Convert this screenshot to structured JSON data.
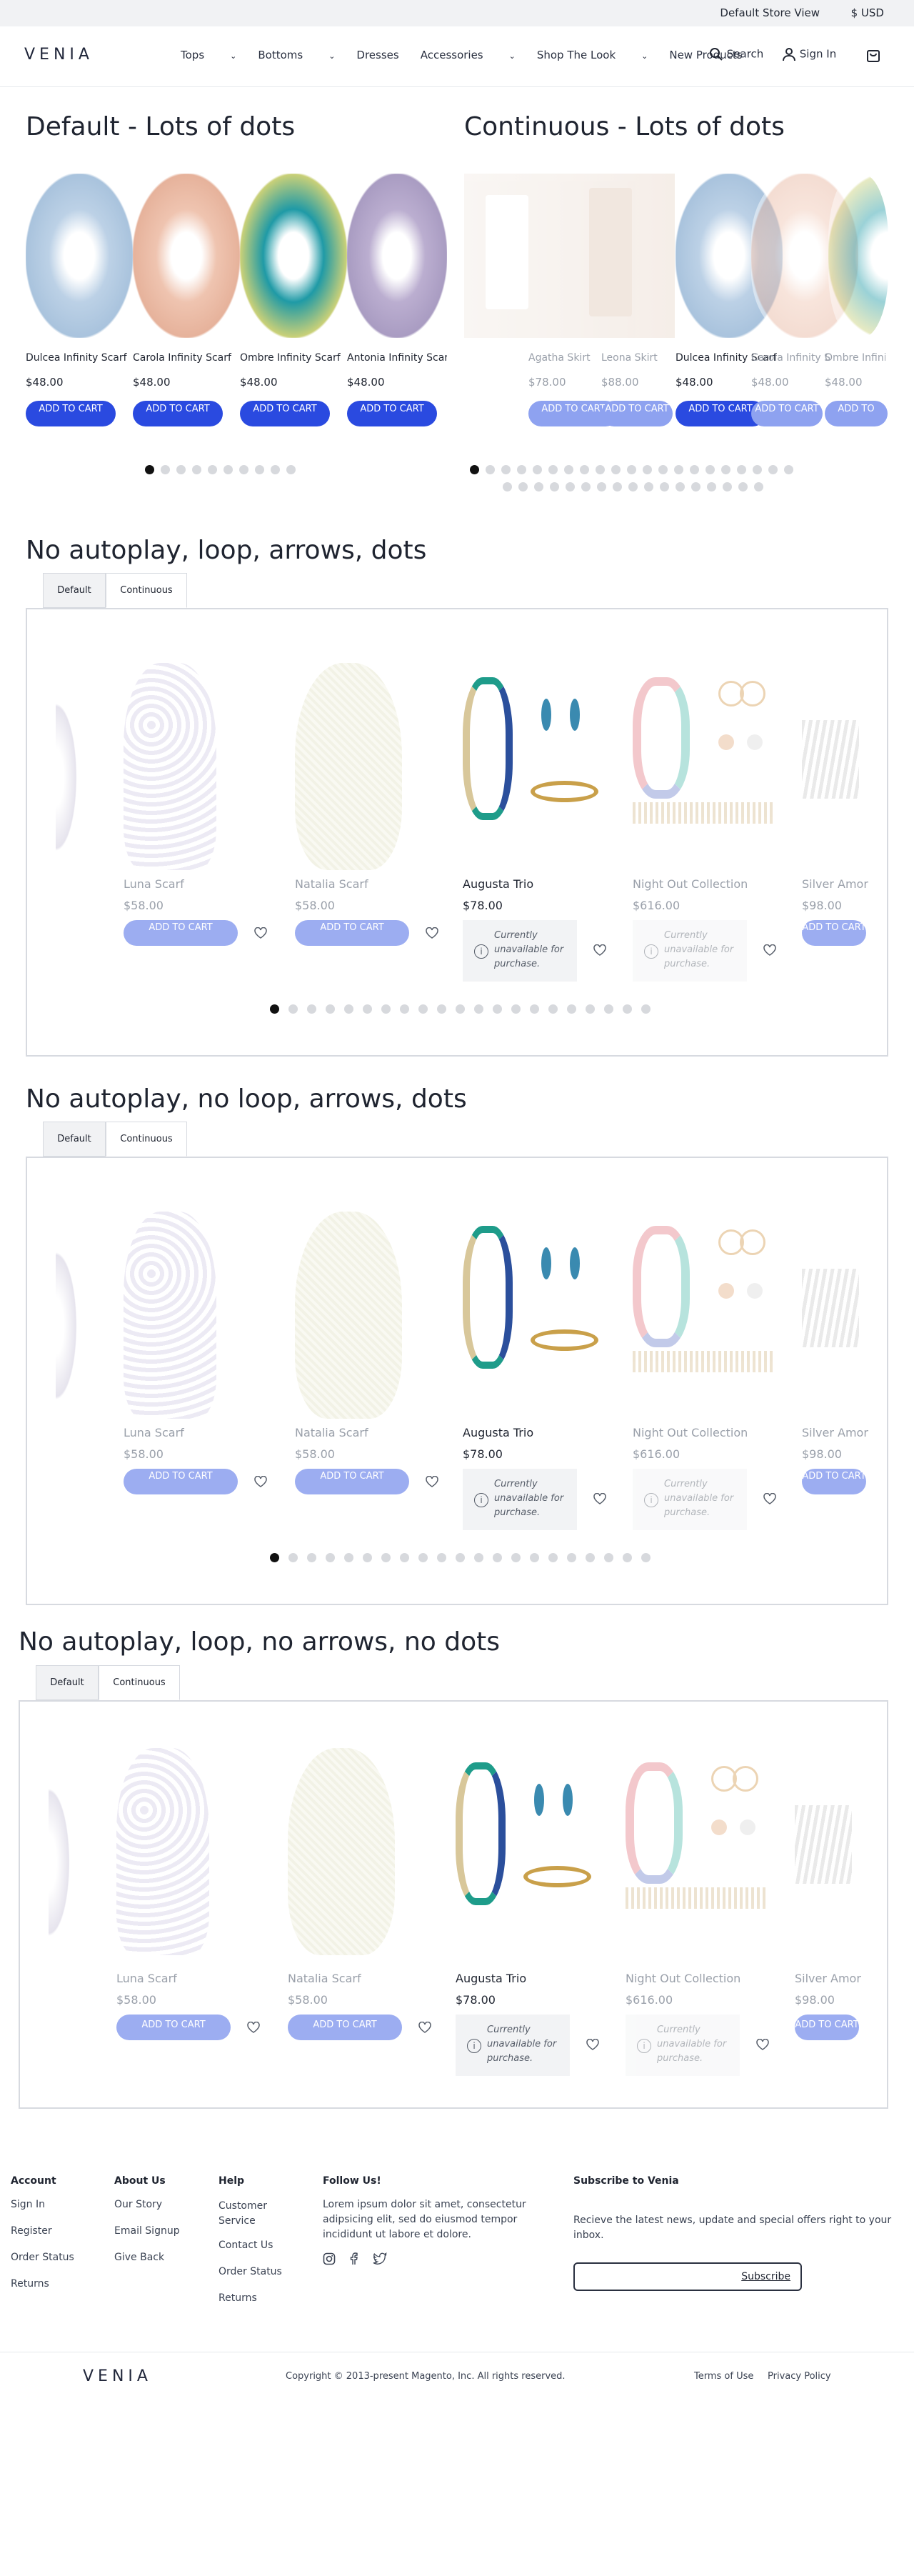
{
  "topbar": {
    "store_view": "Default Store View",
    "currency": "$ USD"
  },
  "header": {
    "logo": "VENIA",
    "nav": [
      "Tops",
      "Bottoms",
      "Dresses",
      "Accessories",
      "Shop The Look",
      "New Products"
    ],
    "search": "Search",
    "signin": "Sign In"
  },
  "section1": {
    "title": "Default - Lots of dots",
    "products": [
      {
        "name": "Dulcea Infinity Scarf",
        "price": "$48.00",
        "button": "ADD TO CART",
        "color": "#bcd1e6"
      },
      {
        "name": "Carola Infinity Scarf",
        "price": "$48.00",
        "button": "ADD TO CART",
        "color": "#efc4b0"
      },
      {
        "name": "Ombre Infinity Scarf",
        "price": "$48.00",
        "button": "ADD TO CART",
        "color": "#1f9aa6"
      },
      {
        "name": "Antonia Infinity Scarf",
        "price": "$48.00",
        "button": "ADD TO CART",
        "color": "#bbaed0"
      }
    ]
  },
  "section2": {
    "title": "Continuous - Lots of dots",
    "products": [
      {
        "name": "Agatha Skirt",
        "price": "$78.00",
        "button": "ADD TO CART"
      },
      {
        "name": "Leona Skirt",
        "price": "$88.00",
        "button": "ADD TO CART"
      },
      {
        "name": "Dulcea Infinity Scarf",
        "price": "$48.00",
        "button": "ADD TO CART"
      },
      {
        "name": "Carola Infinity Scarf",
        "price": "$48.00",
        "button": "ADD TO CART"
      },
      {
        "name": "Ombre Infinity Scarf",
        "price": "$48.00",
        "button": "ADD TO"
      }
    ]
  },
  "tabs": {
    "default": "Default",
    "continuous": "Continuous"
  },
  "section3": {
    "title": "No autoplay, loop, arrows, dots"
  },
  "section4": {
    "title": "No autoplay, no loop, arrows, dots"
  },
  "section5": {
    "title": "No autoplay, loop, no arrows, no dots"
  },
  "accessories": [
    {
      "name": "Luna Scarf",
      "price": "$58.00",
      "button": "ADD TO CART"
    },
    {
      "name": "Natalia Scarf",
      "price": "$58.00",
      "button": "ADD TO CART"
    },
    {
      "name": "Augusta Trio",
      "price": "$78.00",
      "unavailable": "Currently unavailable for purchase."
    },
    {
      "name": "Night Out Collection",
      "price": "$616.00",
      "unavailable": "Currently unavailable for purchase."
    },
    {
      "name": "Silver Amor",
      "price": "$98.00",
      "button": "ADD TO CART"
    }
  ],
  "footer": {
    "account": {
      "title": "Account",
      "links": [
        "Sign In",
        "Register",
        "Order Status",
        "Returns"
      ]
    },
    "about": {
      "title": "About Us",
      "links": [
        "Our Story",
        "Email Signup",
        "Give Back"
      ]
    },
    "help": {
      "title": "Help",
      "links": [
        "Customer Service",
        "Contact Us",
        "Order Status",
        "Returns"
      ]
    },
    "follow": {
      "title": "Follow Us!",
      "text": "Lorem ipsum dolor sit amet, consectetur adipsicing elit, sed do eiusmod tempor incididunt ut labore et dolore."
    },
    "subscribe": {
      "title": "Subscribe to Venia",
      "text": "Recieve the latest news, update and special offers right to your inbox.",
      "button": "Subscribe"
    },
    "logo": "VENIA",
    "copyright": "Copyright © 2013-present Magento, Inc. All rights reserved.",
    "terms": "Terms of Use",
    "privacy": "Privacy Policy"
  }
}
